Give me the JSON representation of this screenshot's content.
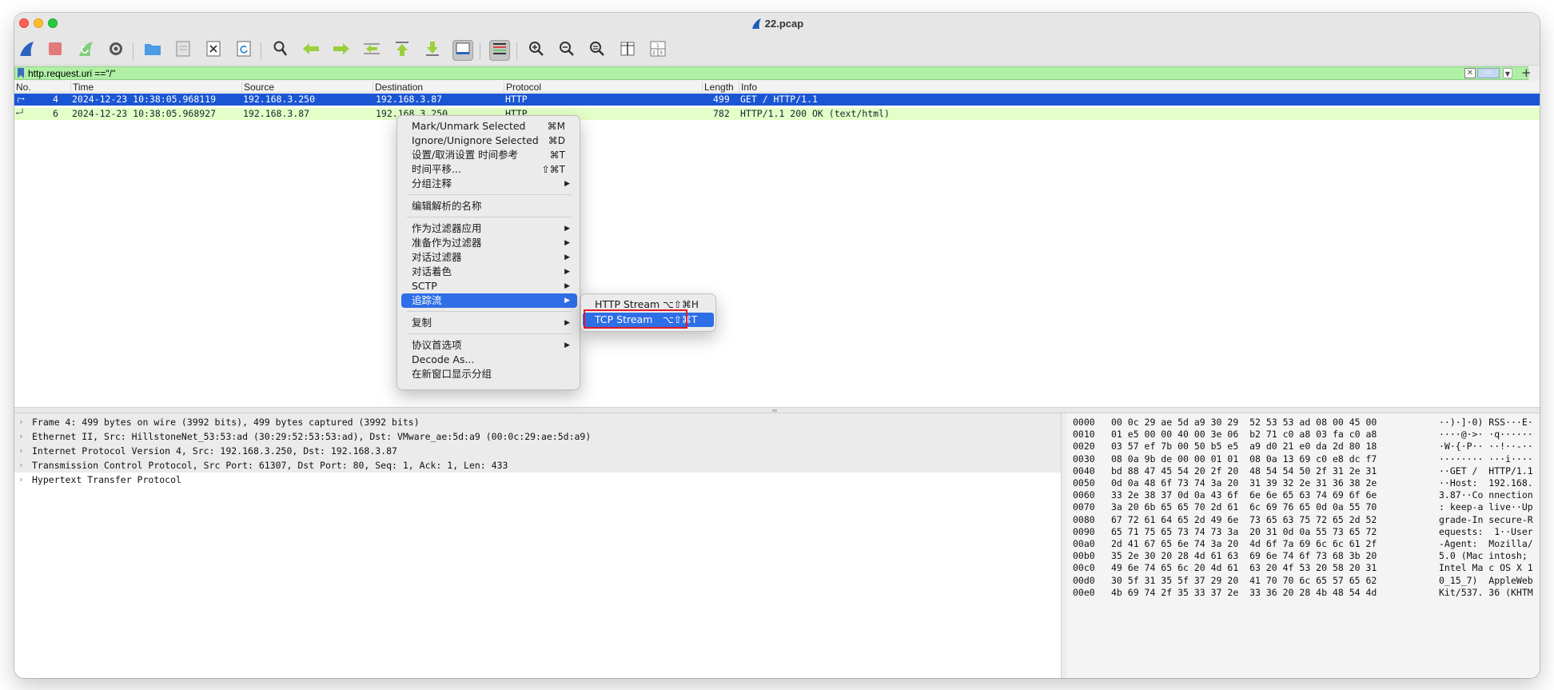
{
  "window": {
    "title": "22.pcap"
  },
  "toolbar": {
    "buttons": [
      {
        "name": "start-capture-icon"
      },
      {
        "name": "stop-capture-icon"
      },
      {
        "name": "restart-capture-icon"
      },
      {
        "name": "capture-options-icon"
      },
      {
        "name": "open-file-icon"
      },
      {
        "name": "save-file-icon"
      },
      {
        "name": "close-file-icon"
      },
      {
        "name": "reload-file-icon"
      },
      {
        "name": "find-packet-icon"
      },
      {
        "name": "go-back-icon"
      },
      {
        "name": "go-forward-icon"
      },
      {
        "name": "go-to-packet-icon"
      },
      {
        "name": "go-first-packet-icon"
      },
      {
        "name": "go-last-packet-icon"
      },
      {
        "name": "autoscroll-icon"
      },
      {
        "name": "colorize-icon"
      },
      {
        "name": "zoom-in-icon"
      },
      {
        "name": "zoom-out-icon"
      },
      {
        "name": "zoom-normal-icon"
      },
      {
        "name": "resize-columns-icon"
      },
      {
        "name": "layout-icon"
      }
    ]
  },
  "filter": {
    "value": "http.request.uri ==\"/\"",
    "clear_label": "✕",
    "apply_label": "⇨",
    "add_label": "+"
  },
  "packet_list": {
    "columns": [
      "No.",
      "Time",
      "Source",
      "Destination",
      "Protocol",
      "Length",
      "Info"
    ],
    "rows": [
      {
        "no": "4",
        "time": "2024-12-23 10:38:05.968119",
        "source": "192.168.3.250",
        "destination": "192.168.3.87",
        "protocol": "HTTP",
        "length": "499",
        "info": "GET / HTTP/1.1",
        "selected": true
      },
      {
        "no": "6",
        "time": "2024-12-23 10:38:05.968927",
        "source": "192.168.3.87",
        "destination": "192.168.3.250",
        "protocol": "HTTP",
        "length": "782",
        "info": "HTTP/1.1 200 OK  (text/html)",
        "selected": false
      }
    ]
  },
  "context_menu": {
    "items": [
      {
        "label": "Mark/Unmark Selected",
        "shortcut": "⌘M"
      },
      {
        "label": "Ignore/Unignore Selected",
        "shortcut": "⌘D"
      },
      {
        "label": "设置/取消设置 时间参考",
        "shortcut": "⌘T"
      },
      {
        "label": "时间平移...",
        "shortcut": "⇧⌘T"
      },
      {
        "label": "分组注释",
        "submenu": true
      },
      {
        "label": "编辑解析的名称"
      },
      {
        "label": "作为过滤器应用",
        "submenu": true
      },
      {
        "label": "准备作为过滤器",
        "submenu": true
      },
      {
        "label": "对话过滤器",
        "submenu": true
      },
      {
        "label": "对话着色",
        "submenu": true
      },
      {
        "label": "SCTP",
        "submenu": true
      },
      {
        "label": "追踪流",
        "submenu": true,
        "highlighted": true
      },
      {
        "label": "复制",
        "submenu": true
      },
      {
        "label": "协议首选项",
        "submenu": true
      },
      {
        "label": "Decode As..."
      },
      {
        "label": "在新窗口显示分组"
      }
    ],
    "follow_submenu": [
      {
        "label": "HTTP Stream",
        "shortcut": "⌥⇧⌘H"
      },
      {
        "label": "TCP Stream",
        "shortcut": "⌥⇧⌘T",
        "highlighted": true
      }
    ]
  },
  "details": {
    "lines": [
      "Frame 4: 499 bytes on wire (3992 bits), 499 bytes captured (3992 bits)",
      "Ethernet II, Src: HillstoneNet_53:53:ad (30:29:52:53:53:ad), Dst: VMware_ae:5d:a9 (00:0c:29:ae:5d:a9)",
      "Internet Protocol Version 4, Src: 192.168.3.250, Dst: 192.168.3.87",
      "Transmission Control Protocol, Src Port: 61307, Dst Port: 80, Seq: 1, Ack: 1, Len: 433",
      "Hypertext Transfer Protocol"
    ]
  },
  "bytes": {
    "rows": [
      {
        "offset": "0000",
        "hex": "00 0c 29 ae 5d a9 30 29  52 53 53 ad 08 00 45 00",
        "ascii": "··)·]·0) RSS···E·"
      },
      {
        "offset": "0010",
        "hex": "01 e5 00 00 40 00 3e 06  b2 71 c0 a8 03 fa c0 a8",
        "ascii": "····@·>· ·q······"
      },
      {
        "offset": "0020",
        "hex": "03 57 ef 7b 00 50 b5 e5  a9 d0 21 e0 da 2d 80 18",
        "ascii": "·W·{·P·· ··!··-··"
      },
      {
        "offset": "0030",
        "hex": "08 0a 9b de 00 00 01 01  08 0a 13 69 c0 e8 dc f7",
        "ascii": "········ ···i····"
      },
      {
        "offset": "0040",
        "hex": "bd 88 47 45 54 20 2f 20  48 54 54 50 2f 31 2e 31",
        "ascii": "··GET /  HTTP/1.1"
      },
      {
        "offset": "0050",
        "hex": "0d 0a 48 6f 73 74 3a 20  31 39 32 2e 31 36 38 2e",
        "ascii": "··Host:  192.168."
      },
      {
        "offset": "0060",
        "hex": "33 2e 38 37 0d 0a 43 6f  6e 6e 65 63 74 69 6f 6e",
        "ascii": "3.87··Co nnection"
      },
      {
        "offset": "0070",
        "hex": "3a 20 6b 65 65 70 2d 61  6c 69 76 65 0d 0a 55 70",
        "ascii": ": keep-a live··Up"
      },
      {
        "offset": "0080",
        "hex": "67 72 61 64 65 2d 49 6e  73 65 63 75 72 65 2d 52",
        "ascii": "grade-In secure-R"
      },
      {
        "offset": "0090",
        "hex": "65 71 75 65 73 74 73 3a  20 31 0d 0a 55 73 65 72",
        "ascii": "equests:  1··User"
      },
      {
        "offset": "00a0",
        "hex": "2d 41 67 65 6e 74 3a 20  4d 6f 7a 69 6c 6c 61 2f",
        "ascii": "-Agent:  Mozilla/"
      },
      {
        "offset": "00b0",
        "hex": "35 2e 30 20 28 4d 61 63  69 6e 74 6f 73 68 3b 20",
        "ascii": "5.0 (Mac intosh; "
      },
      {
        "offset": "00c0",
        "hex": "49 6e 74 65 6c 20 4d 61  63 20 4f 53 20 58 20 31",
        "ascii": "Intel Ma c OS X 1"
      },
      {
        "offset": "00d0",
        "hex": "30 5f 31 35 5f 37 29 20  41 70 70 6c 65 57 65 62",
        "ascii": "0_15_7)  AppleWeb"
      },
      {
        "offset": "00e0",
        "hex": "4b 69 74 2f 35 33 37 2e  33 36 20 28 4b 48 54 4d",
        "ascii": "Kit/537. 36 (KHTM"
      }
    ]
  },
  "colors": {
    "selected_row": "#1a55d3",
    "http_row": "#e4ffc7",
    "filter_valid": "#aff0a4",
    "menu_highlight": "#2e6ee6",
    "annotation_box": "#e01b24"
  }
}
